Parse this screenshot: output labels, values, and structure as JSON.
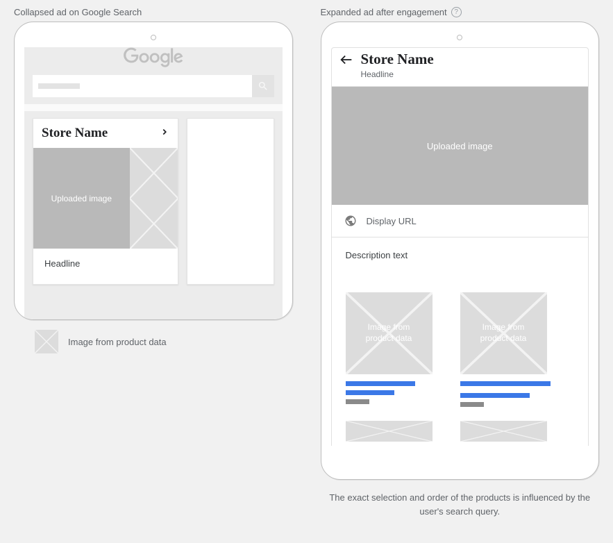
{
  "collapsed": {
    "title": "Collapsed ad on Google Search",
    "store_name": "Store Name",
    "uploaded_image_label": "Uploaded image",
    "headline": "Headline",
    "legend_text": "Image from product data"
  },
  "expanded": {
    "title": "Expanded ad after engagement",
    "store_name": "Store Name",
    "headline": "Headline",
    "uploaded_image_label": "Uploaded image",
    "display_url": "Display URL",
    "description": "Description text",
    "product_image_label": "Image from product data",
    "footnote": "The exact selection and order of the products is influenced by the user's search query."
  }
}
